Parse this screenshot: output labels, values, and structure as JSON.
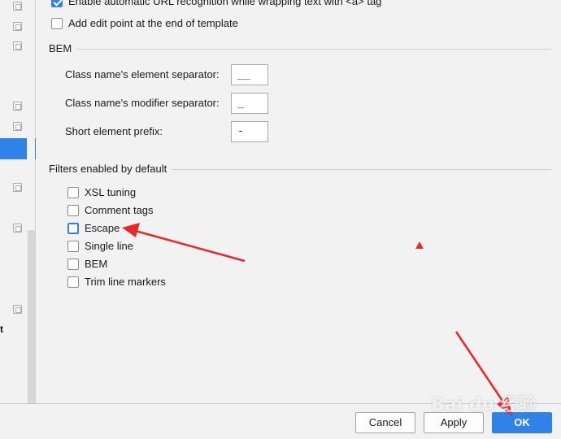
{
  "options": {
    "url_recognition_label": "Enable automatic URL recognition while wrapping text with <a> tag",
    "url_recognition_checked": true,
    "edit_point_label": "Add edit point at the end of template",
    "edit_point_checked": false
  },
  "bem": {
    "group_title": "BEM",
    "element_separator_label": "Class name's element separator:",
    "element_separator_value": "__",
    "modifier_separator_label": "Class name's modifier separator:",
    "modifier_separator_value": "_",
    "short_prefix_label": "Short element prefix:",
    "short_prefix_value": "-"
  },
  "filters": {
    "group_title": "Filters enabled by default",
    "items": [
      {
        "label": "XSL tuning",
        "checked": false
      },
      {
        "label": "Comment tags",
        "checked": false
      },
      {
        "label": "Escape",
        "checked": false
      },
      {
        "label": "Single line",
        "checked": false
      },
      {
        "label": "BEM",
        "checked": false
      },
      {
        "label": "Trim line markers",
        "checked": false
      }
    ]
  },
  "tree": {
    "partial_label": "t"
  },
  "buttons": {
    "cancel": "Cancel",
    "apply": "Apply",
    "ok": "OK"
  },
  "watermark": {
    "text": "Bai du 经验"
  },
  "colors": {
    "accent": "#2f82e8",
    "annotation_red": "#e8282b"
  }
}
